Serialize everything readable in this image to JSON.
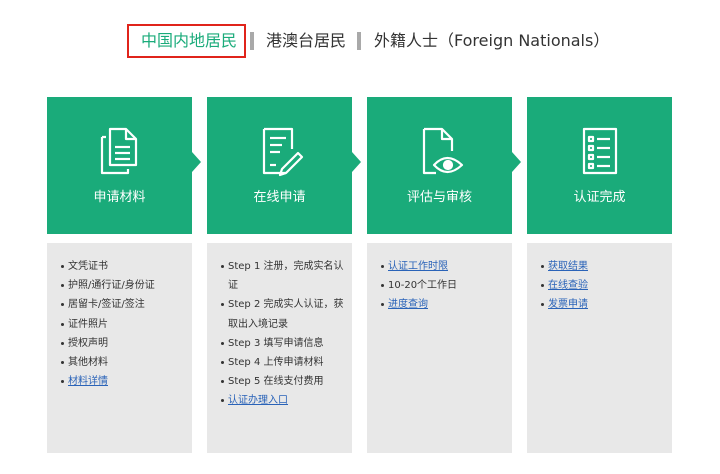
{
  "tabs": {
    "mainland": "中国内地居民",
    "hmt": "港澳台居民",
    "foreign": "外籍人士（Foreign Nationals）"
  },
  "steps": [
    {
      "title": "申请材料",
      "icon": "documents-icon"
    },
    {
      "title": "在线申请",
      "icon": "form-edit-icon"
    },
    {
      "title": "评估与审核",
      "icon": "document-eye-icon"
    },
    {
      "title": "认证完成",
      "icon": "checklist-icon"
    }
  ],
  "panels": {
    "materials": {
      "items": [
        "文凭证书",
        "护照/通行证/身份证",
        "居留卡/签证/签注",
        "证件照片",
        "授权声明",
        "其他材料"
      ],
      "link": "材料详情"
    },
    "online": {
      "items": [
        "Step 1 注册，完成实名认证",
        "Step 2 完成实人认证，获取出入境记录",
        "Step 3 填写申请信息",
        "Step 4 上传申请材料",
        "Step 5 在线支付费用"
      ],
      "link": "认证办理入口"
    },
    "review": {
      "link1": "认证工作时限",
      "text": "10-20个工作日",
      "link2": "进度查询"
    },
    "done": {
      "link1": "获取结果",
      "link2": "在线查验",
      "link3": "发票申请"
    }
  },
  "colors": {
    "green": "#1aab7a",
    "active_border": "#e0241b",
    "link": "#2a63b8",
    "panel_bg": "#e8e8e8"
  }
}
